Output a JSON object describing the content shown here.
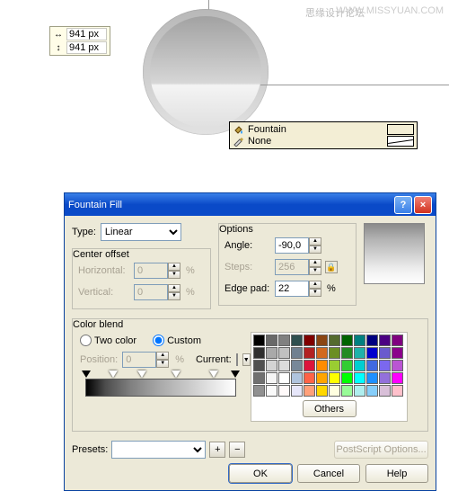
{
  "watermark_left": "思缘设计论坛",
  "watermark_right": "WWW.MISSYUAN.COM",
  "size_tip": {
    "w": "941",
    "h": "941",
    "unit": "px"
  },
  "fobar": {
    "fill_label": "Fountain",
    "outline_label": "None",
    "fill_color": "#808080"
  },
  "dialog": {
    "title": "Fountain Fill",
    "type_label": "Type:",
    "type_value": "Linear",
    "center_offset_label": "Center offset",
    "horizontal_label": "Horizontal:",
    "horizontal_value": "0",
    "vertical_label": "Vertical:",
    "vertical_value": "0",
    "options_label": "Options",
    "angle_label": "Angle:",
    "angle_value": "-90,0",
    "steps_label": "Steps:",
    "steps_value": "256",
    "edgepad_label": "Edge pad:",
    "edgepad_value": "22",
    "pct": "%",
    "colorblend_label": "Color blend",
    "twocolor_label": "Two color",
    "custom_label": "Custom",
    "position_label": "Position:",
    "position_value": "0",
    "current_label": "Current:",
    "others_label": "Others",
    "presets_label": "Presets:",
    "postscript_label": "PostScript Options...",
    "ok": "OK",
    "cancel": "Cancel",
    "help": "Help"
  },
  "palette_colors": [
    "#000000",
    "#696969",
    "#808080",
    "#2f4f4f",
    "#800000",
    "#8b4513",
    "#556b2f",
    "#006400",
    "#008080",
    "#000080",
    "#4b0082",
    "#800080",
    "#2f2f2f",
    "#a9a9a9",
    "#c0c0c0",
    "#708090",
    "#b22222",
    "#d2691e",
    "#6b8e23",
    "#228b22",
    "#20b2aa",
    "#0000cd",
    "#6a5acd",
    "#8b008b",
    "#505050",
    "#d3d3d3",
    "#dcdcdc",
    "#778899",
    "#dc143c",
    "#ff8c00",
    "#9acd32",
    "#32cd32",
    "#00ced1",
    "#4169e1",
    "#7b68ee",
    "#ba55d3",
    "#707070",
    "#f5f5f5",
    "#ffffff",
    "#b0c4de",
    "#ff6347",
    "#ffa500",
    "#ffff00",
    "#00ff00",
    "#00ffff",
    "#1e90ff",
    "#9370db",
    "#ff00ff",
    "#909090",
    "#fafafa",
    "#fffafa",
    "#e6e6fa",
    "#ffa07a",
    "#ffd700",
    "#ffffe0",
    "#98fb98",
    "#afeeee",
    "#87cefa",
    "#d8bfd8",
    "#ffc0cb"
  ]
}
